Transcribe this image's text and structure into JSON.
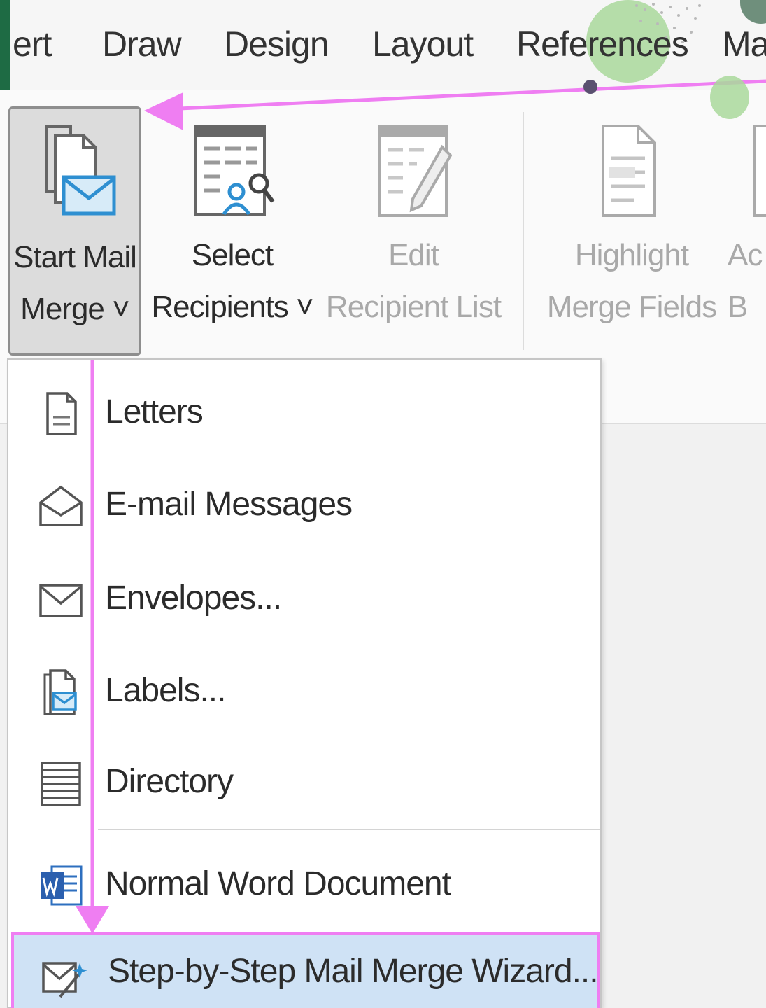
{
  "tabs": [
    "ert",
    "Draw",
    "Design",
    "Layout",
    "References",
    "Ma"
  ],
  "ribbon": {
    "start_mail_merge": {
      "line1": "Start Mail",
      "line2": "Merge ˅"
    },
    "select_recipients": {
      "line1": "Select",
      "line2": "Recipients ˅"
    },
    "edit_recipient_list": {
      "line1": "Edit",
      "line2": "Recipient List"
    },
    "highlight_merge_fields": {
      "line1": "Highlight",
      "line2": "Merge Fields"
    },
    "next_button": {
      "line1": "Ac",
      "line2": "B"
    }
  },
  "menu": {
    "items": [
      {
        "label": "Letters",
        "icon": "letter-page-icon"
      },
      {
        "label": "E-mail Messages",
        "icon": "open-envelope-icon"
      },
      {
        "label": "Envelopes...",
        "icon": "envelope-icon"
      },
      {
        "label": "Labels...",
        "icon": "label-page-icon"
      },
      {
        "label": "Directory",
        "icon": "directory-list-icon"
      },
      {
        "label": "Normal Word Document",
        "icon": "word-document-icon"
      },
      {
        "label": "Step-by-Step Mail Merge Wizard...",
        "icon": "wizard-icon"
      }
    ]
  },
  "colors": {
    "accent_blue": "#2e8fd1",
    "annotation_pink": "#ef7ef2",
    "highlight_bg": "#cfe2f5",
    "word_green": "#1e6b44"
  }
}
